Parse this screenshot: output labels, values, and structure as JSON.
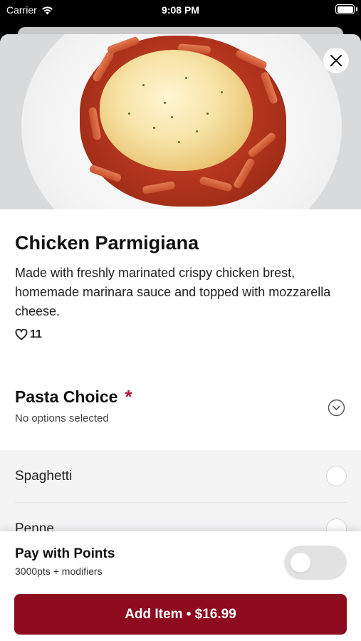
{
  "status_bar": {
    "carrier": "Carrier",
    "time": "9:08 PM"
  },
  "product": {
    "title": "Chicken Parmigiana",
    "description": "Made with freshly marinated crispy chicken brest, homemade marinara sauce and topped with mozzarella cheese.",
    "likes": "11"
  },
  "pasta_section": {
    "title": "Pasta Choice",
    "required_marker": "*",
    "subtitle": "No options selected",
    "options": [
      {
        "label": "Spaghetti"
      },
      {
        "label": "Penne"
      }
    ]
  },
  "bottom_bar": {
    "points_title": "Pay with Points",
    "points_subtitle": "3000pts + modifiers",
    "pay_with_points_enabled": false,
    "add_button_label": "Add Item • $16.99"
  },
  "colors": {
    "brand": "#8d0a1f",
    "required": "#b3143a"
  },
  "icons": {
    "close": "close-icon",
    "heart": "heart-icon",
    "chevron": "chevron-down-icon",
    "wifi": "wifi-icon",
    "battery": "battery-icon"
  }
}
